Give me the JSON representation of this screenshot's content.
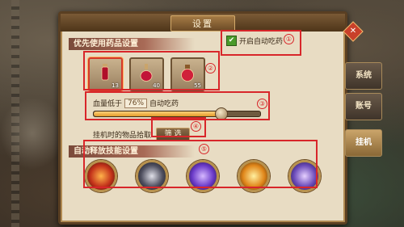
{
  "title": "设置",
  "potion_section": {
    "header": "优先使用药品设置",
    "slots": [
      {
        "qty": "13"
      },
      {
        "qty": "40"
      },
      {
        "qty": "55"
      }
    ]
  },
  "auto_potion": {
    "label": "开启自动吃药",
    "checked": true
  },
  "hp": {
    "prefix": "血量低于",
    "value": "76%",
    "suffix": "自动吃药",
    "percent": 76
  },
  "pickup": {
    "label": "挂机时的物品拾取",
    "button": "筛 选"
  },
  "skills_section": {
    "header": "自动释放技能设置"
  },
  "annotations": [
    "①",
    "②",
    "③",
    "④",
    "⑤"
  ],
  "tabs": [
    "系统",
    "账号",
    "挂机"
  ],
  "colors": {
    "annotation": "#d8262a",
    "checkbox": "#4a9a2a",
    "slider": "#e29a2a"
  }
}
